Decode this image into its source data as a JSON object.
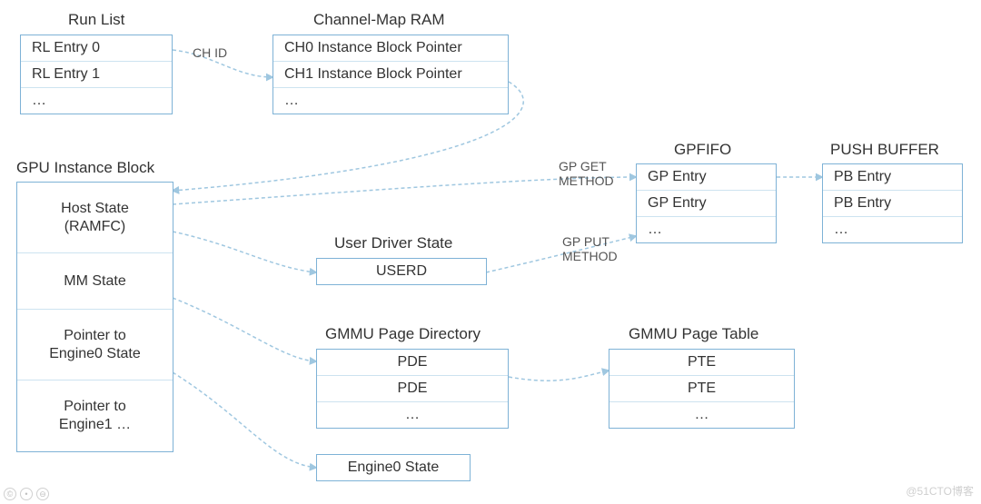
{
  "diagram": {
    "runList": {
      "title": "Run List",
      "rows": [
        "RL Entry 0",
        "RL Entry 1",
        "…"
      ]
    },
    "channelMap": {
      "title": "Channel-Map RAM",
      "rows": [
        "CH0 Instance Block Pointer",
        "CH1 Instance Block Pointer",
        "…"
      ]
    },
    "instanceBlock": {
      "title": "GPU Instance Block",
      "rows": [
        "Host State\n(RAMFC)",
        "MM State",
        "Pointer to\nEngine0 State",
        "Pointer to\nEngine1 …"
      ]
    },
    "userDriver": {
      "title": "User Driver State",
      "rows": [
        "USERD"
      ]
    },
    "gpfifo": {
      "title": "GPFIFO",
      "rows": [
        "GP Entry",
        "GP Entry",
        "…"
      ]
    },
    "pushBuffer": {
      "title": "PUSH BUFFER",
      "rows": [
        "PB Entry",
        "PB Entry",
        "…"
      ]
    },
    "pageDir": {
      "title": "GMMU Page Directory",
      "rows": [
        "PDE",
        "PDE",
        "…"
      ]
    },
    "pageTable": {
      "title": "GMMU Page Table",
      "rows": [
        "PTE",
        "PTE",
        "…"
      ]
    },
    "engineState": {
      "rows": [
        "Engine0 State"
      ]
    },
    "edges": {
      "chId": "CH ID",
      "gpGet": "GP GET\nMETHOD",
      "gpPut": "GP PUT\nMETHOD"
    },
    "watermark": "@51CTO博客"
  }
}
